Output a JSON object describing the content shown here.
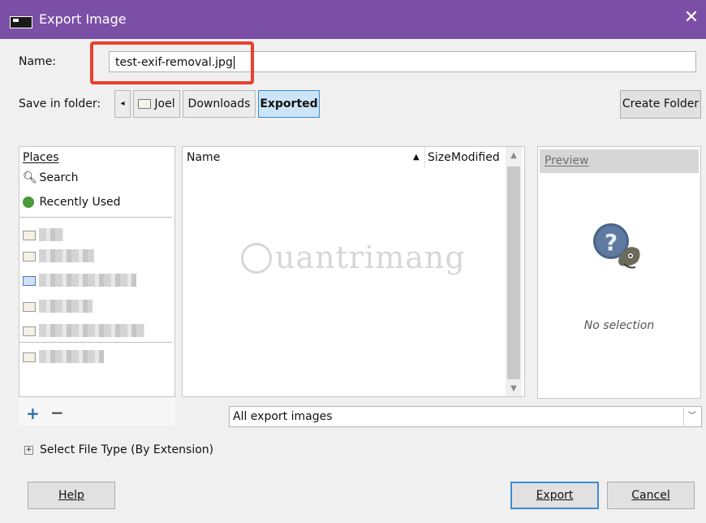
{
  "window": {
    "title": "Export Image",
    "close_glyph": "✕"
  },
  "name_row": {
    "label": "Name:",
    "value": "test-exif-removal.jpg"
  },
  "folder_row": {
    "label": "Save in folder:",
    "back_glyph": "◂",
    "crumbs": [
      "Joel",
      "Downloads",
      "Exported"
    ],
    "active_crumb": "Exported",
    "create_folder": "Create Folder"
  },
  "places": {
    "header": "Places",
    "items": [
      {
        "label": "Search",
        "icon": "search-icon"
      },
      {
        "label": "Recently Used",
        "icon": "recent-icon"
      }
    ],
    "add_glyph": "+",
    "remove_glyph": "−"
  },
  "files": {
    "columns": [
      "Name",
      "Size",
      "Modified"
    ],
    "sort_glyph": "▲",
    "watermark": "uantrimang"
  },
  "preview": {
    "header": "Preview",
    "status": "No selection"
  },
  "filter": {
    "value": "All export images",
    "dropdown_glyph": "﹀"
  },
  "file_type": {
    "expander": "+",
    "label": "Select File Type (By Extension)"
  },
  "buttons": {
    "help": "Help",
    "export": "Export",
    "cancel": "Cancel"
  },
  "colors": {
    "titlebar": "#7a4fa5",
    "highlight": "#e8412f",
    "active_crumb": "#cce4f7"
  }
}
